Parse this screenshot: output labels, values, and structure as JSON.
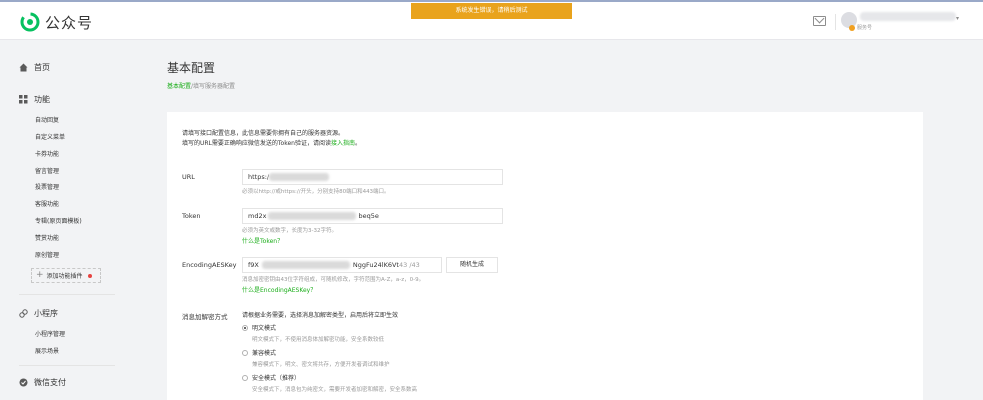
{
  "header": {
    "app_name": "公众号",
    "banner_text": "系统发生错误，请稍后测试",
    "account_type": "服务号"
  },
  "sidebar": {
    "home": "首页",
    "features": "功能",
    "features_items": [
      "自动回复",
      "自定义菜单",
      "卡券功能",
      "留言管理",
      "投票管理",
      "客服功能",
      "专辑(原页面模板)",
      "赞赏功能",
      "原创管理"
    ],
    "add_plugin": "添加功能插件",
    "miniprogram": "小程序",
    "miniprogram_items": [
      "小程序管理",
      "展示场景"
    ],
    "wechat_pay": "微信支付"
  },
  "page": {
    "title": "基本配置",
    "breadcrumb_link": "基本配置",
    "breadcrumb_sep": "/",
    "breadcrumb_current": "填写服务器配置"
  },
  "form": {
    "intro_line1": "请填写接口配置信息，此信息需要你拥有自己的服务器资源。",
    "intro_line2_prefix": "填写的URL需要正确响应微信发送的Token验证，请阅读",
    "intro_line2_link": "接入指南",
    "intro_line2_suffix": "。",
    "url_label": "URL",
    "url_value": "https:/",
    "url_hint": "必须以http://或https://开头，分别支持80端口和443端口。",
    "token_label": "Token",
    "token_value_prefix": "md2x",
    "token_value_suffix": "beq5e",
    "token_hint": "必须为英文或数字，长度为3-32字符。",
    "token_link": "什么是Token？",
    "aes_label": "EncodingAESKey",
    "aes_value_prefix": "f9X",
    "aes_value_suffix": "NggFu24lK6Vt",
    "aes_count": "43 /43",
    "aes_button": "随机生成",
    "aes_hint": "消息加密密钥由43位字符组成，可随机修改，字符范围为A-Z，a-z，0-9。",
    "aes_link": "什么是EncodingAESKey？",
    "enc_label": "消息加解密方式",
    "enc_hint": "请根据业务需要，选择消息加解密类型，启用后将立即生效",
    "modes": [
      {
        "label": "明文模式",
        "desc": "明文模式下，不使用消息体加解密功能，安全系数较低",
        "selected": true
      },
      {
        "label": "兼容模式",
        "desc": "兼容模式下，明文、密文将共存，方便开发者调试和维护",
        "selected": false
      },
      {
        "label": "安全模式（推荐）",
        "desc": "安全模式下，消息包为纯密文，需要开发者加密和解密，安全系数高",
        "selected": false
      }
    ]
  },
  "colors": {
    "accent_green": "#1aad19",
    "banner_orange": "#e9a31c",
    "page_bg": "#f2f3f5"
  },
  "icons": [
    "logo-icon",
    "mail-icon",
    "home-icon",
    "grid-icon",
    "link-icon",
    "pay-icon"
  ]
}
